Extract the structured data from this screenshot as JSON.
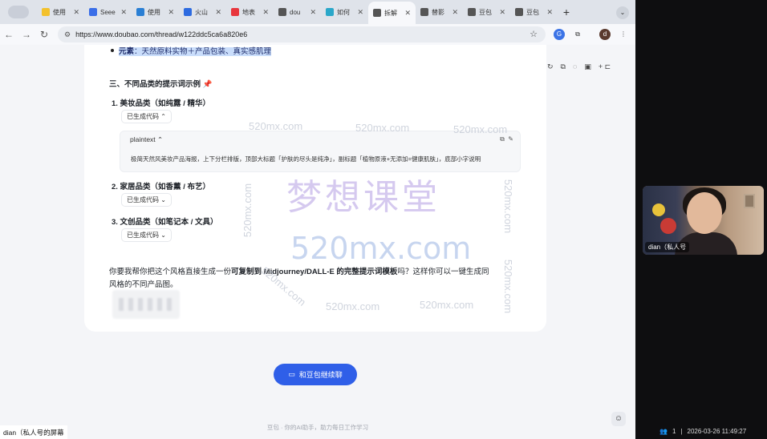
{
  "browser": {
    "tabs": [
      {
        "label": "使用",
        "color": "#f3c12c"
      },
      {
        "label": "Seee",
        "color": "#3a6ee8"
      },
      {
        "label": "使用",
        "color": "#2a7fd4"
      },
      {
        "label": "火山",
        "color": "#2d6be0"
      },
      {
        "label": "地表",
        "color": "#e8363d"
      },
      {
        "label": "dou",
        "color": "#555555"
      },
      {
        "label": "如何",
        "color": "#2aa7c9"
      },
      {
        "label": "拆解",
        "color": "#555555",
        "active": true
      },
      {
        "label": "替影",
        "color": "#555555"
      },
      {
        "label": "豆包",
        "color": "#555555"
      },
      {
        "label": "豆包",
        "color": "#555555"
      }
    ],
    "url": "https://www.doubao.com/thread/w122ddc5ca6a820e6"
  },
  "content": {
    "elements_label": "元素",
    "elements_text": "：天然原料实物＋产品包装、真实感肌理",
    "section3_title": "三、不同品类的提示词示例",
    "item1": "1. 美妆品类（如纯露 / 精华）",
    "item2": "2. 家居品类（如香薰 / 布艺）",
    "item3": "3. 文创品类（如笔记本 / 文具）",
    "code_chip": "已生成代码",
    "code_lang": "plaintext",
    "code_line": "极简天然风美妆产品海报，上下分栏排版，顶部大标题「护肤的尽头是纯净」，副标题「植物原液+无添加=健康肌肤」，底部小字说明",
    "question_pre": "你要我帮你把这个风格直接生成一份",
    "question_bold": "可复制到 Midjourney/DALL-E 的完整提示词模板",
    "question_post": "吗？这样你可以一键生成同",
    "question_line2": "风格的不同产品图。",
    "cta": "和豆包继续聊",
    "footer": "豆包 · 你的AI助手，助力每日工作学习"
  },
  "watermark": {
    "small": "520mx.com",
    "cn": "梦想课堂",
    "big": "520mx.com"
  },
  "meeting": {
    "participant_name": "dian（私人号",
    "share_label": "dian（私人号的屏幕",
    "participants": "1",
    "timestamp": "2026-03-26 11:49:27"
  }
}
